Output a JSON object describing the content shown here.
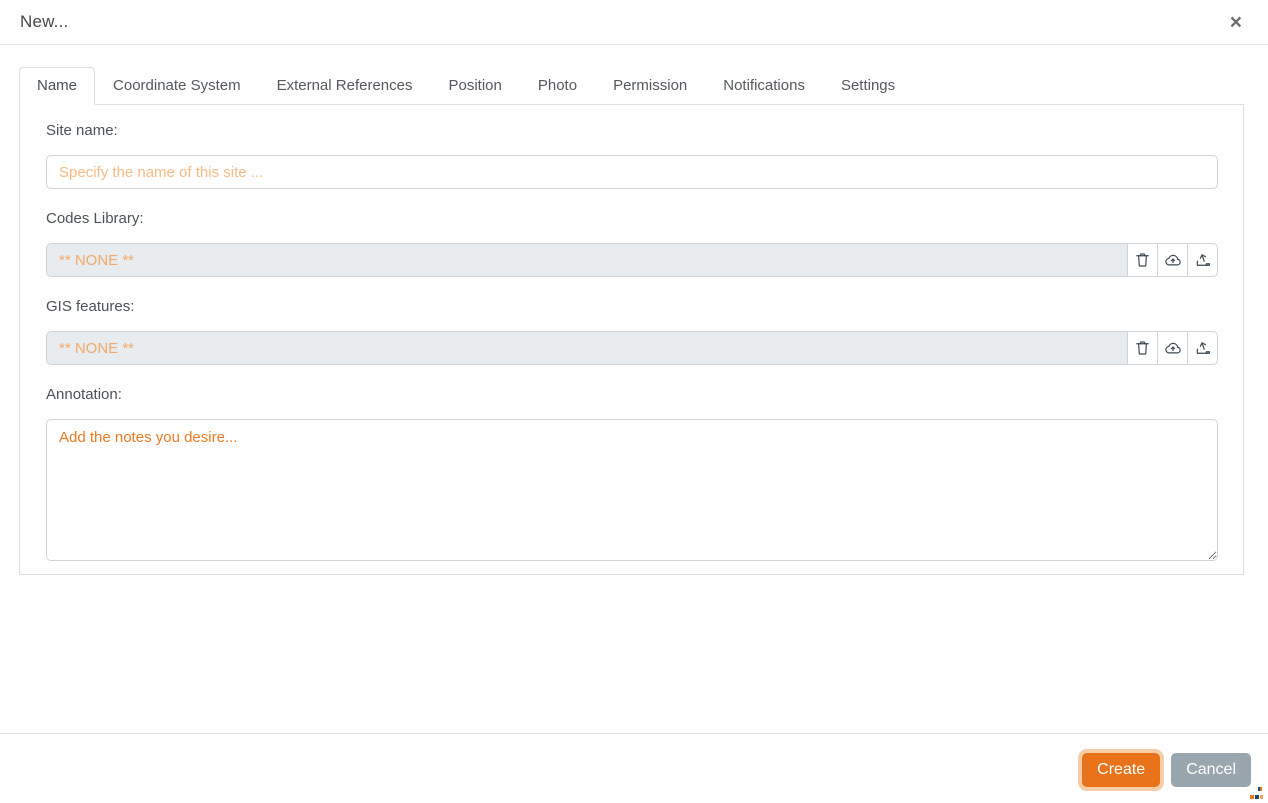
{
  "dialog": {
    "title": "New...",
    "close_label": "×"
  },
  "tabs": [
    {
      "label": "Name",
      "active": true
    },
    {
      "label": "Coordinate System",
      "active": false
    },
    {
      "label": "External References",
      "active": false
    },
    {
      "label": "Position",
      "active": false
    },
    {
      "label": "Photo",
      "active": false
    },
    {
      "label": "Permission",
      "active": false
    },
    {
      "label": "Notifications",
      "active": false
    },
    {
      "label": "Settings",
      "active": false
    }
  ],
  "form": {
    "site_name": {
      "label": "Site name:",
      "value": "",
      "placeholder": "Specify the name of this site ..."
    },
    "codes_library": {
      "label": "Codes Library:",
      "value": "** NONE **",
      "buttons": [
        "trash-icon",
        "cloud-upload-icon",
        "upload-icon"
      ]
    },
    "gis_features": {
      "label": "GIS features:",
      "value": "** NONE **",
      "buttons": [
        "trash-icon",
        "cloud-upload-icon",
        "upload-icon"
      ]
    },
    "annotation": {
      "label": "Annotation:",
      "value": "",
      "placeholder": "Add the notes you desire..."
    }
  },
  "footer": {
    "create_label": "Create",
    "cancel_label": "Cancel"
  },
  "colors": {
    "accent_orange": "#e8731a",
    "focus_ring_orange": "#f6cda6",
    "placeholder_peach": "#f7bb85",
    "none_value_peach": "#f2a968",
    "annotation_placeholder_orange": "#ee7b22",
    "cancel_gray": "#9aa6ad",
    "panel_border": "#dcdee6",
    "input_border": "#ced4da",
    "disabled_input_bg": "#e9ecef"
  }
}
